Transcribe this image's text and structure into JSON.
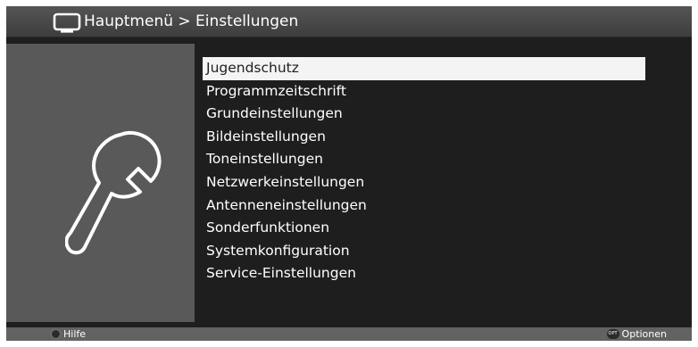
{
  "header": {
    "breadcrumb": "Hauptmenü > Einstellungen",
    "icon": "tv-icon"
  },
  "side_panel": {
    "icon": "wrench-icon"
  },
  "menu": {
    "selected_index": 0,
    "items": [
      {
        "label": "Jugendschutz"
      },
      {
        "label": "Programmzeitschrift"
      },
      {
        "label": "Grundeinstellungen"
      },
      {
        "label": "Bildeinstellungen"
      },
      {
        "label": "Toneinstellungen"
      },
      {
        "label": "Netzwerkeinstellungen"
      },
      {
        "label": "Antenneneinstellungen"
      },
      {
        "label": "Sonderfunktionen"
      },
      {
        "label": "Systemkonfiguration"
      },
      {
        "label": "Service-Einstellungen"
      }
    ]
  },
  "footer": {
    "help_label": "Hilfe",
    "help_button_icon": "round-button-icon",
    "options_badge": "OPT",
    "options_label": "Optionen"
  },
  "colors": {
    "background": "#1e1e1e",
    "header": "#474747",
    "side_panel": "#595959",
    "selection": "#f4f4f4",
    "text": "#ffffff"
  }
}
